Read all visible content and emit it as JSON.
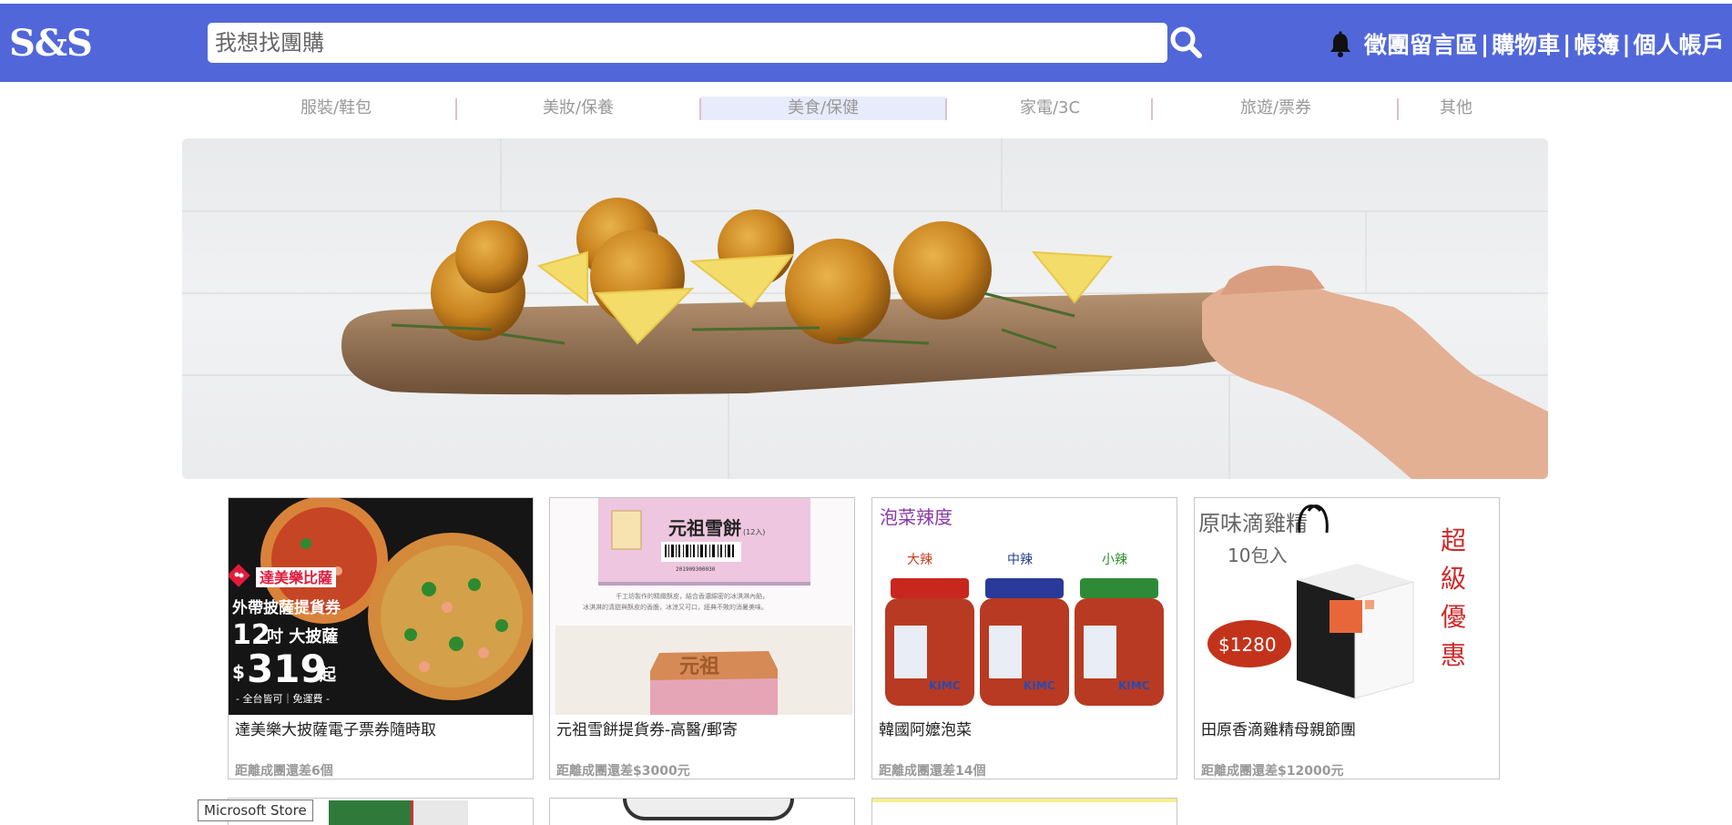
{
  "header": {
    "logo": "S&S",
    "search_placeholder": "我想找團購",
    "links": [
      "徵團留言區",
      "購物車",
      "帳簿",
      "個人帳戶"
    ],
    "separator": "|",
    "background": "#5167d9"
  },
  "categories": [
    "服裝/鞋包",
    "美妝/保養",
    "美食/保健",
    "家電/3C",
    "旅遊/票券",
    "其他"
  ],
  "active_category": "美食/保健",
  "products": [
    {
      "title": "達美樂大披薩電子票券隨時取",
      "remaining": "距離成團還差6個",
      "image": {
        "brand": "達美樂比薩",
        "line1": "外帶披薩提貨券",
        "size": "12",
        "size_unit": "吋 大披薩",
        "price": "319",
        "price_suffix": "起",
        "foot": "- 全台皆可｜免運費 -"
      }
    },
    {
      "title": "元祖雪餅提貨券-高醫/郵寄",
      "remaining": "距離成團還差$3000元",
      "image": {
        "heading": "元祖雪餅",
        "sub": "(12入)",
        "barcode_number": "201909300030",
        "desc1": "千工坊製作的精緻酥皮，結合香濃綿密的冰淇淋內餡，",
        "desc2": "冰淇淋的清甜與酥皮的香脆，冰涼又可口，經典不敗的消暑美味。",
        "stamp": "元祖"
      }
    },
    {
      "title": "韓國阿嬤泡菜",
      "remaining": "距離成團還差14個",
      "image": {
        "heading": "泡菜辣度",
        "levels": [
          "大辣",
          "中辣",
          "小辣"
        ],
        "label": "KIMC"
      }
    },
    {
      "title": "田原香滴雞精母親節團",
      "remaining": "距離成團還差$12000元",
      "image": {
        "heading1": "原味滴雞精",
        "heading2": "10包入",
        "price": "$1280",
        "promo": [
          "超",
          "級",
          "優",
          "惠"
        ]
      }
    }
  ],
  "tooltip": "Microsoft Store",
  "colors": {
    "accent": "#5167d9",
    "category_active": "#e7ebfb",
    "category_text": "#999999"
  }
}
